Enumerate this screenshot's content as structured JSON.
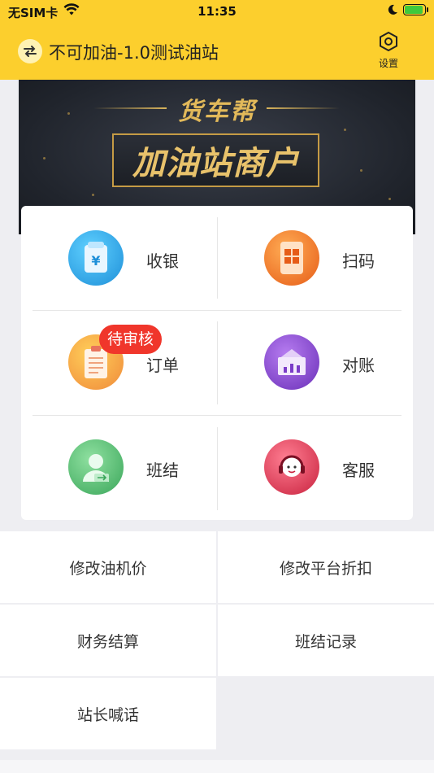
{
  "status_bar": {
    "carrier": "无SIM卡",
    "time": "11:35"
  },
  "nav": {
    "title": "不可加油-1.0测试油站",
    "settings_label": "设置"
  },
  "banner": {
    "brand": "货车帮",
    "headline": "加油站商户"
  },
  "grid": [
    {
      "label": "收银",
      "icon": "cashier-icon",
      "color": "#28a9e6"
    },
    {
      "label": "扫码",
      "icon": "scan-icon",
      "color": "#f07a2a"
    },
    {
      "label": "订单",
      "icon": "order-icon",
      "color": "#f2a23a",
      "badge": "待审核"
    },
    {
      "label": "对账",
      "icon": "reconcile-icon",
      "color": "#7b3cc8"
    },
    {
      "label": "班结",
      "icon": "shift-icon",
      "color": "#4cb86a"
    },
    {
      "label": "客服",
      "icon": "service-icon",
      "color": "#e0405a"
    }
  ],
  "menu": [
    {
      "label": "修改油机价"
    },
    {
      "label": "修改平台折扣"
    },
    {
      "label": "财务结算"
    },
    {
      "label": "班结记录"
    },
    {
      "label": "站长喊话"
    }
  ]
}
